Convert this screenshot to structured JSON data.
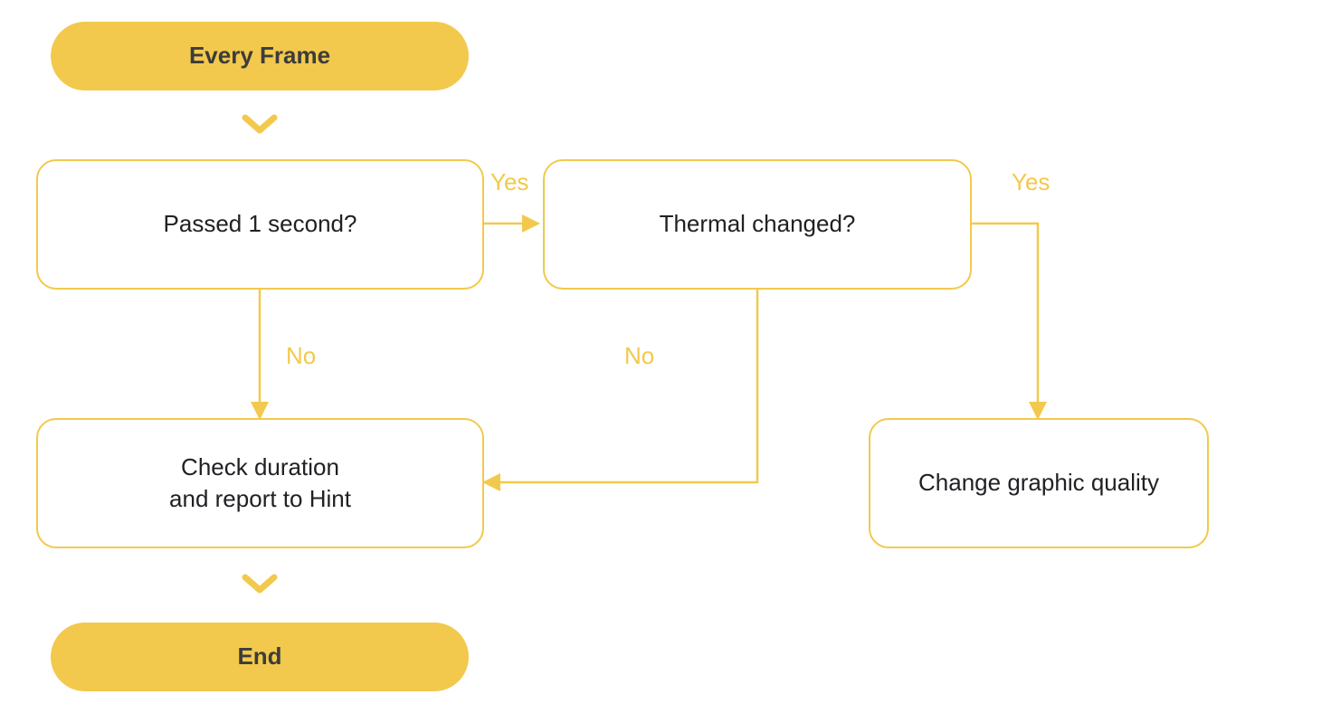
{
  "colors": {
    "accent": "#f2c94c",
    "text": "#202124",
    "pill_text": "#3c3c3c",
    "background": "#ffffff"
  },
  "nodes": {
    "start": {
      "label": "Every Frame",
      "type": "terminator"
    },
    "decision1": {
      "label": "Passed 1 second?",
      "type": "decision"
    },
    "decision2": {
      "label": "Thermal changed?",
      "type": "decision"
    },
    "process_report": {
      "label": "Check duration\nand report to Hint",
      "type": "process"
    },
    "process_quality": {
      "label": "Change graphic quality",
      "type": "process"
    },
    "end": {
      "label": "End",
      "type": "terminator"
    }
  },
  "edges": {
    "start_to_d1": {
      "from": "start",
      "to": "decision1",
      "label": ""
    },
    "d1_yes": {
      "from": "decision1",
      "to": "decision2",
      "label": "Yes"
    },
    "d1_no": {
      "from": "decision1",
      "to": "process_report",
      "label": "No"
    },
    "d2_yes": {
      "from": "decision2",
      "to": "process_quality",
      "label": "Yes"
    },
    "d2_no": {
      "from": "decision2",
      "to": "process_report",
      "label": "No"
    },
    "report_to_end": {
      "from": "process_report",
      "to": "end",
      "label": ""
    }
  }
}
